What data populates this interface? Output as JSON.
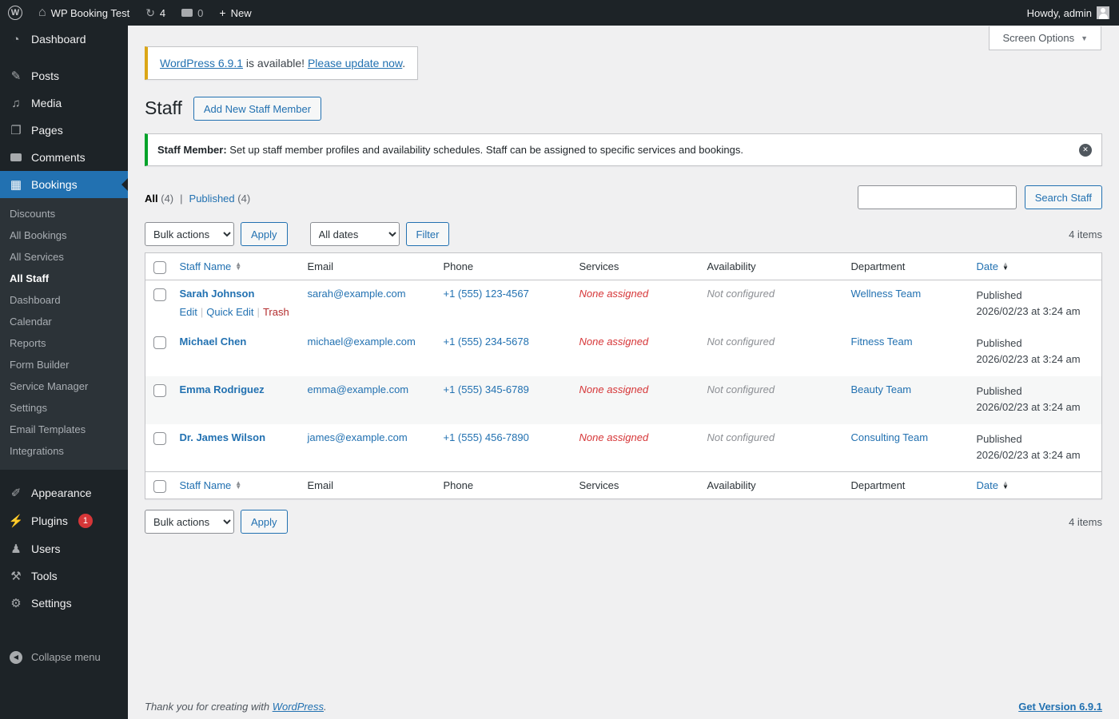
{
  "admin_bar": {
    "wp_logo": "W",
    "site_name": "WP Booking Test",
    "update_count": "4",
    "comment_count": "0",
    "new_label": "New",
    "howdy": "Howdy, admin"
  },
  "screen_options": {
    "label": "Screen Options"
  },
  "sidebar": {
    "dashboard": "Dashboard",
    "posts": "Posts",
    "media": "Media",
    "pages": "Pages",
    "comments": "Comments",
    "bookings": "Bookings",
    "submenu": {
      "discounts": "Discounts",
      "all_bookings": "All Bookings",
      "all_services": "All Services",
      "all_staff": "All Staff",
      "dashboard": "Dashboard",
      "calendar": "Calendar",
      "reports": "Reports",
      "form_builder": "Form Builder",
      "service_manager": "Service Manager",
      "settings": "Settings",
      "email_templates": "Email Templates",
      "integrations": "Integrations"
    },
    "appearance": "Appearance",
    "plugins": "Plugins",
    "plugins_badge": "1",
    "users": "Users",
    "tools": "Tools",
    "settings": "Settings",
    "collapse_menu": "Collapse menu"
  },
  "main": {
    "update_notice": {
      "version_link": "WordPress 6.9.1",
      "middle_text": " is available! ",
      "update_link": "Please update now",
      "period": "."
    },
    "page_title": "Staff",
    "add_new_button": "Add New Staff Member",
    "info_notice": {
      "bold": "Staff Member:",
      "text": " Set up staff member profiles and availability schedules. Staff can be assigned to specific services and bookings."
    },
    "views": {
      "all": "All",
      "all_count": "(4)",
      "published": "Published",
      "published_count": "(4)"
    },
    "search_button": "Search Staff",
    "tablenav": {
      "bulk_actions": "Bulk actions",
      "apply": "Apply",
      "all_dates": "All dates",
      "filter": "Filter",
      "items_count": "4 items"
    },
    "table": {
      "headers": {
        "name": "Staff Name",
        "email": "Email",
        "phone": "Phone",
        "services": "Services",
        "availability": "Availability",
        "department": "Department",
        "date": "Date"
      },
      "row_actions": {
        "edit": "Edit",
        "quick_edit": "Quick Edit",
        "trash": "Trash"
      },
      "rows": [
        {
          "name": "Sarah Johnson",
          "email": "sarah@example.com",
          "phone": "+1 (555) 123-4567",
          "services": "None assigned",
          "availability": "Not configured",
          "department": "Wellness Team",
          "status": "Published",
          "date": "2026/02/23 at 3:24 am"
        },
        {
          "name": "Michael Chen",
          "email": "michael@example.com",
          "phone": "+1 (555) 234-5678",
          "services": "None assigned",
          "availability": "Not configured",
          "department": "Fitness Team",
          "status": "Published",
          "date": "2026/02/23 at 3:24 am"
        },
        {
          "name": "Emma Rodriguez",
          "email": "emma@example.com",
          "phone": "+1 (555) 345-6789",
          "services": "None assigned",
          "availability": "Not configured",
          "department": "Beauty Team",
          "status": "Published",
          "date": "2026/02/23 at 3:24 am"
        },
        {
          "name": "Dr. James Wilson",
          "email": "james@example.com",
          "phone": "+1 (555) 456-7890",
          "services": "None assigned",
          "availability": "Not configured",
          "department": "Consulting Team",
          "status": "Published",
          "date": "2026/02/23 at 3:24 am"
        }
      ]
    }
  },
  "footer": {
    "thanks_prefix": "Thank you for creating with ",
    "wordpress_link": "WordPress",
    "thanks_suffix": ".",
    "version_link": "Get Version 6.9.1"
  },
  "colors": {
    "accent": "#2271b1",
    "menu_bg": "#1d2327",
    "success_border": "#00a32a",
    "warning_border": "#dba617",
    "danger": "#d63638"
  }
}
